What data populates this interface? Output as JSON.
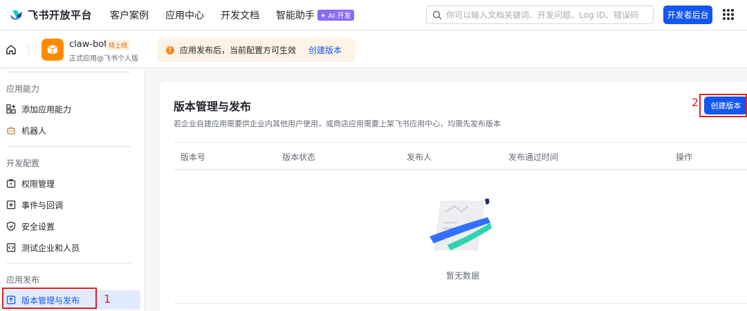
{
  "nav": {
    "logo_text": "飞书开放平台",
    "items": [
      "客户案例",
      "应用中心",
      "开发文档",
      "智能助手"
    ],
    "ai_badge": "✦ AI 开发",
    "search_placeholder": "你可以输入文档关键词、开发问题、Log ID、错误码",
    "dev_button": "开发者后台"
  },
  "app": {
    "name": "claw-bot",
    "status": "待上线",
    "type": "正式应用@飞书个人版",
    "notice": "应用发布后，当前配置方可生效",
    "notice_link": "创建版本"
  },
  "sidebar": {
    "section1": "应用能力",
    "add_capability": "添加应用能力",
    "robot": "机器人",
    "section2": "开发配置",
    "permissions": "权限管理",
    "events": "事件与回调",
    "security": "安全设置",
    "test_enterprise": "测试企业和人员",
    "section3": "应用发布",
    "version_release": "版本管理与发布"
  },
  "main": {
    "title": "版本管理与发布",
    "description": "若企业自建应用需要供企业内其他用户使用，或商店应用需要上架飞书应用中心，均需先发布版本",
    "create_button": "创建版本",
    "columns": [
      "版本号",
      "版本状态",
      "发布人",
      "发布通过时间",
      "操作"
    ],
    "empty_text": "暂无数据"
  },
  "annotations": {
    "label1": "1",
    "label2": "2"
  },
  "colors": {
    "accent": "#1456f0",
    "annotation": "#e02020",
    "app_icon": "#ff8a00"
  }
}
